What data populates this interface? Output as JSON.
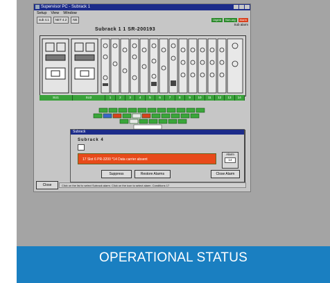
{
  "window": {
    "title": "Supervisor PC - Subrack 1",
    "menu": [
      "Setup",
      "View",
      "Window"
    ],
    "toolbar_buttons": [
      "sub 4.1",
      "NET 4.2",
      "NE"
    ],
    "status_badges": [
      {
        "label": "Urgent",
        "color": "#2b8a2b"
      },
      {
        "label": "Non-urg",
        "color": "#2b8a2b"
      },
      {
        "label": "Alarm",
        "color": "#d9411e"
      }
    ],
    "alarms_label": "Sub alarm"
  },
  "subrack": {
    "label": "Subrack  1   1     SR-200193",
    "slots": [
      "SU1",
      "SU2",
      "1",
      "2",
      "3",
      "4",
      "5",
      "6",
      "7",
      "8",
      "9",
      "10",
      "11",
      "12",
      "13",
      "14"
    ]
  },
  "dialog": {
    "title": "Subrack",
    "subtitle": "Subrack  4",
    "alert_text": "17  Slot 6  PR-3200 *14  Data carrier absent",
    "spin_label": "Alarm",
    "spin_value": "14",
    "buttons": [
      "Suppress",
      "Restore Alarms",
      "Close Alarm"
    ]
  },
  "footer": {
    "close_label": "Close",
    "status_text": "Click on the list to select Subrack alarm.  Click on the icon to select alarm.     Conditions   17"
  },
  "caption": {
    "text": "OPERATIONAL STATUS"
  }
}
